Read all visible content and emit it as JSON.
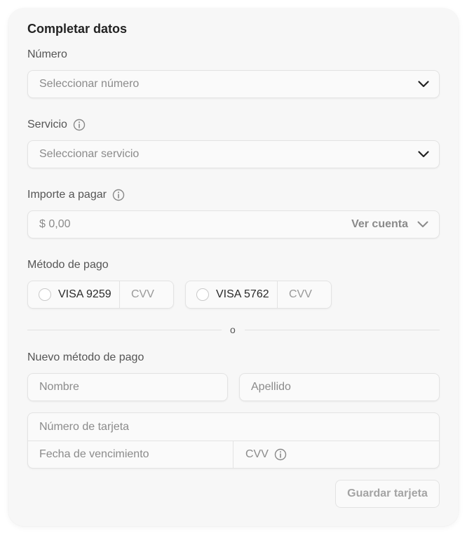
{
  "form": {
    "title": "Completar datos",
    "numero": {
      "label": "Número",
      "placeholder": "Seleccionar número"
    },
    "servicio": {
      "label": "Servicio",
      "placeholder": "Seleccionar servicio"
    },
    "importe": {
      "label": "Importe a pagar",
      "value": "$ 0,00",
      "ver_cuenta": "Ver cuenta"
    },
    "metodo": {
      "label": "Método de pago",
      "cards": [
        {
          "number": "VISA 9259",
          "cvv": "CVV"
        },
        {
          "number": "VISA 5762",
          "cvv": "CVV"
        }
      ]
    },
    "divider_text": "o",
    "nuevo": {
      "label": "Nuevo método de pago",
      "nombre": "Nombre",
      "apellido": "Apellido",
      "numero_tarjeta": "Número de tarjeta",
      "vencimiento": "Fecha de vencimiento",
      "cvv": "CVV"
    },
    "save_button": "Guardar tarjeta"
  },
  "icons": {
    "info": "info-icon",
    "chevron": "chevron-down-icon"
  }
}
